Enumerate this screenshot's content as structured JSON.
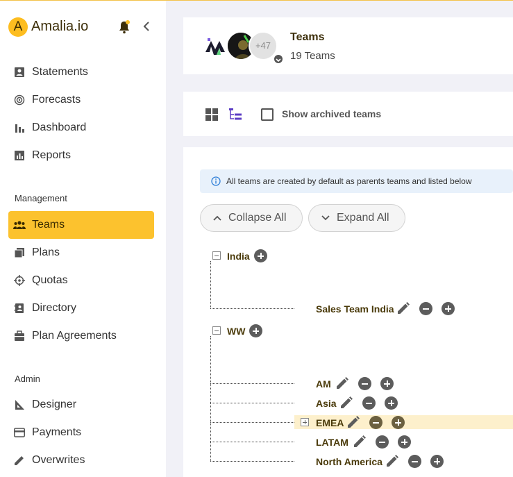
{
  "app": {
    "name": "Amalia.io",
    "logo_letter": "A"
  },
  "sidebar": {
    "items": [
      {
        "label": "Statements",
        "icon": "user-card-icon"
      },
      {
        "label": "Forecasts",
        "icon": "target-icon"
      },
      {
        "label": "Dashboard",
        "icon": "bar-chart-icon"
      },
      {
        "label": "Reports",
        "icon": "report-icon"
      }
    ],
    "management_title": "Management",
    "management_items": [
      {
        "label": "Teams",
        "icon": "people-icon",
        "active": true
      },
      {
        "label": "Plans",
        "icon": "pages-icon"
      },
      {
        "label": "Quotas",
        "icon": "crosshair-icon"
      },
      {
        "label": "Directory",
        "icon": "contacts-book-icon"
      },
      {
        "label": "Plan Agreements",
        "icon": "briefcase-icon"
      }
    ],
    "admin_title": "Admin",
    "admin_items": [
      {
        "label": "Designer",
        "icon": "set-square-icon"
      },
      {
        "label": "Payments",
        "icon": "credit-card-icon"
      },
      {
        "label": "Overwrites",
        "icon": "pencil-icon"
      }
    ]
  },
  "header": {
    "title": "Teams",
    "subtitle": "19 Teams",
    "avatar_more": "+47"
  },
  "toolbar": {
    "show_archived_label": "Show archived teams",
    "show_archived_checked": false
  },
  "info": {
    "text": "All teams are created by default as parents teams and listed below"
  },
  "buttons": {
    "collapse_all": "Collapse All",
    "expand_all": "Expand All"
  },
  "tree": {
    "roots": [
      {
        "name": "India",
        "children": [
          {
            "name": "Sales Team India"
          }
        ]
      },
      {
        "name": "WW",
        "children": [
          {
            "name": "AM"
          },
          {
            "name": "Asia"
          },
          {
            "name": "EMEA",
            "highlighted": true,
            "collapsed": true
          },
          {
            "name": "LATAM"
          },
          {
            "name": "North America"
          }
        ]
      }
    ]
  },
  "colors": {
    "accent": "#fcc22e",
    "highlight_row": "#fdf0cc",
    "info_bg": "#e8f1fb",
    "info_icon": "#2f7fd8",
    "tree_view_icon": "#5b3cc4"
  }
}
